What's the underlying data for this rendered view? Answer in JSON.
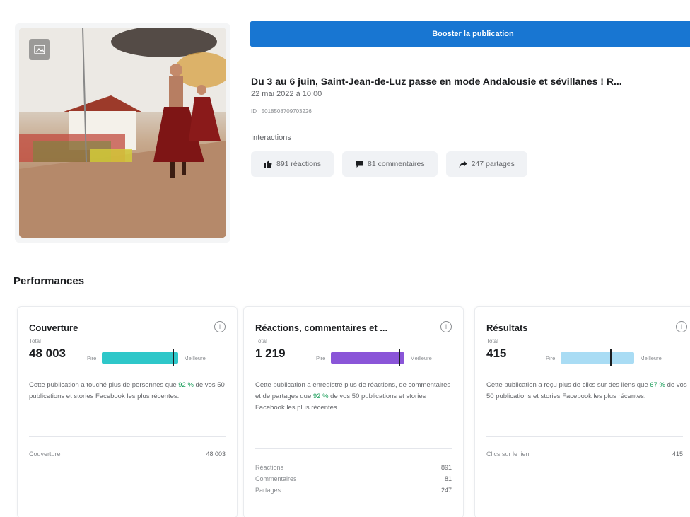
{
  "boost_button": "Booster la publication",
  "post": {
    "title": "Du 3 au 6 juin, Saint-Jean-de-Luz passe en mode Andalousie et sévillanes ! R...",
    "date": "22 mai 2022 à 10:00",
    "id": "ID : 5018508709703226",
    "interactions_label": "Interactions",
    "chips": {
      "reactions": "891 réactions",
      "comments": "81 commentaires",
      "shares": "247 partages"
    }
  },
  "performances_heading": "Performances",
  "cards": [
    {
      "title": "Couverture",
      "total_label": "Total",
      "value": "48 003",
      "bar_low": "Pire",
      "bar_high": "Meilleure",
      "bar_color": "#2ec7c9",
      "bar_level": 0.92,
      "desc_before": "Cette publication a touché plus de personnes que ",
      "desc_pct": "92 %",
      "desc_after": " de vos 50 publications et stories Facebook les plus récentes.",
      "rows": [
        {
          "label": "Couverture",
          "value": "48 003"
        }
      ]
    },
    {
      "title": "Réactions, commentaires et ...",
      "total_label": "Total",
      "value": "1 219",
      "bar_low": "Pire",
      "bar_high": "Meilleure",
      "bar_color": "#8a55d8",
      "bar_level": 0.92,
      "desc_before": "Cette publication a enregistré plus de réactions, de commentaires et de partages que ",
      "desc_pct": "92 %",
      "desc_after": " de vos 50 publications et stories Facebook les plus récentes.",
      "rows": [
        {
          "label": "Réactions",
          "value": "891"
        },
        {
          "label": "Commentaires",
          "value": "81"
        },
        {
          "label": "Partages",
          "value": "247"
        }
      ]
    },
    {
      "title": "Résultats",
      "total_label": "Total",
      "value": "415",
      "bar_low": "Pire",
      "bar_high": "Meilleure",
      "bar_color": "#a9dcf4",
      "bar_level": 0.67,
      "desc_before": "Cette publication a reçu plus de clics sur des liens que ",
      "desc_pct": "67 %",
      "desc_after": " de vos 50 publications et stories Facebook les plus récentes.",
      "rows": [
        {
          "label": "Clics sur le lien",
          "value": "415"
        }
      ]
    }
  ],
  "colors": {
    "accent": "#1876d2",
    "positive": "#1a9e5a"
  }
}
